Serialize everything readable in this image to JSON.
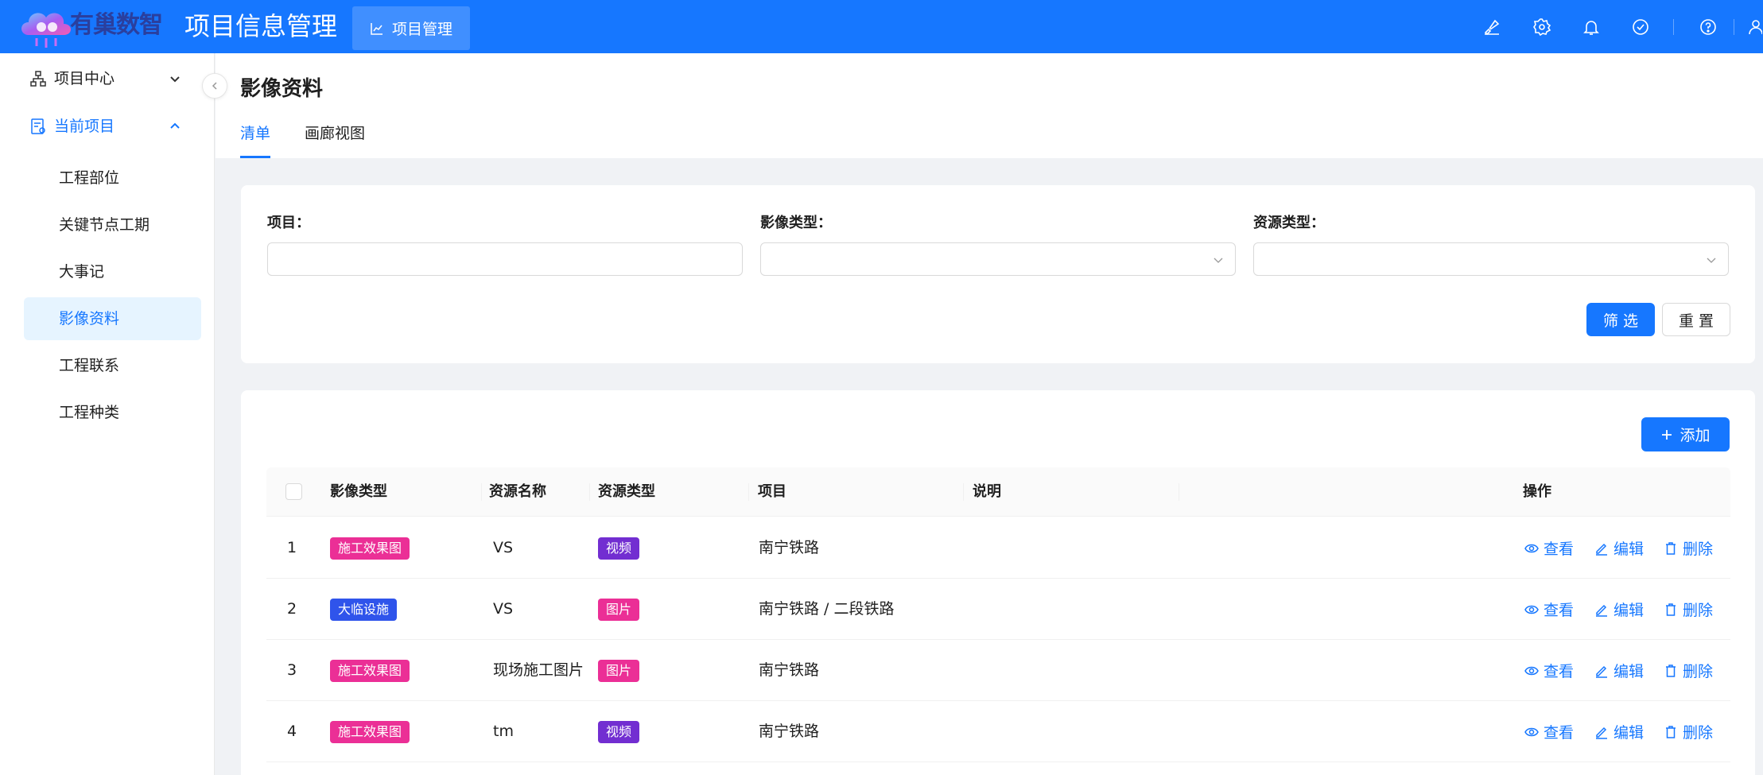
{
  "header": {
    "brand": "有巢数智",
    "app_title": "项目信息管理",
    "nav_label": "项目管理",
    "icons": [
      "brush-icon",
      "gear-icon",
      "bell-icon",
      "check-circle-icon",
      "help-icon",
      "user-icon"
    ]
  },
  "sidebar": {
    "groups": [
      {
        "label": "项目中心",
        "icon": "hierarchy-icon",
        "expanded": false
      },
      {
        "label": "当前项目",
        "icon": "project-doc-icon",
        "expanded": true
      }
    ],
    "items": [
      {
        "label": "工程部位",
        "active": false
      },
      {
        "label": "关键节点工期",
        "active": false
      },
      {
        "label": "大事记",
        "active": false
      },
      {
        "label": "影像资料",
        "active": true
      },
      {
        "label": "工程联系",
        "active": false
      },
      {
        "label": "工程种类",
        "active": false
      }
    ]
  },
  "page": {
    "title": "影像资料",
    "tabs": [
      {
        "label": "清单",
        "active": true
      },
      {
        "label": "画廊视图",
        "active": false
      }
    ]
  },
  "filters": {
    "project_label": "项目：",
    "project_value": "",
    "image_type_label": "影像类型：",
    "image_type_value": "",
    "resource_type_label": "资源类型：",
    "resource_type_value": "",
    "filter_button": "筛 选",
    "reset_button": "重 置"
  },
  "table": {
    "add_button": "添加",
    "columns": [
      "影像类型",
      "资源名称",
      "资源类型",
      "项目",
      "说明",
      "操作"
    ],
    "actions": {
      "view": "查看",
      "edit": "编辑",
      "delete": "删除"
    },
    "rows": [
      {
        "index": "1",
        "image_type": "施工效果图",
        "resource_name": "VS",
        "resource_type": "视频",
        "project": "南宁铁路",
        "note": ""
      },
      {
        "index": "2",
        "image_type": "大临设施",
        "resource_name": "VS",
        "resource_type": "图片",
        "project": "南宁铁路 / 二段铁路",
        "note": ""
      },
      {
        "index": "3",
        "image_type": "施工效果图",
        "resource_name": "现场施工图片",
        "resource_type": "图片",
        "project": "南宁铁路",
        "note": ""
      },
      {
        "index": "4",
        "image_type": "施工效果图",
        "resource_name": "tm",
        "resource_type": "视频",
        "project": "南宁铁路",
        "note": ""
      }
    ]
  },
  "colors": {
    "primary": "#1677ff",
    "tag_construction": "#eb2f96",
    "tag_temporary": "#2f54eb",
    "tag_video": "#722ed1",
    "tag_image": "#eb2f96"
  }
}
